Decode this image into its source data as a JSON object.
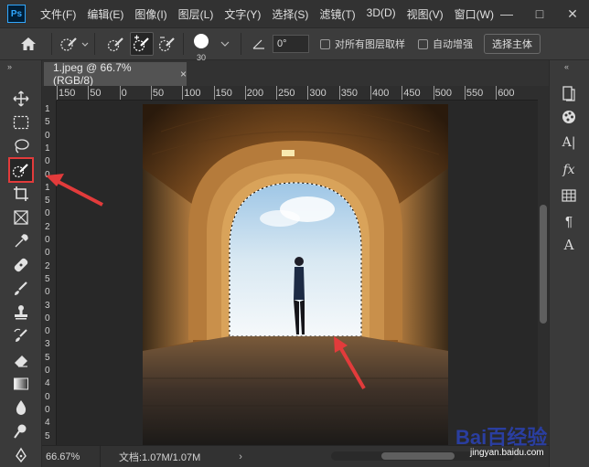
{
  "app": {
    "logo_text": "Ps",
    "menu": [
      "文件(F)",
      "编辑(E)",
      "图像(I)",
      "图层(L)",
      "文字(Y)",
      "选择(S)",
      "滤镜(T)",
      "3D(D)",
      "视图(V)",
      "窗口(W)"
    ]
  },
  "window_controls": {
    "minimize": "—",
    "maximize": "□",
    "close": "✕"
  },
  "options_bar": {
    "brush_size": "30",
    "angle_value": "0°",
    "sample_all_layers_label": "对所有图层取样",
    "auto_enhance_label": "自动增强",
    "select_subject_label": "选择主体"
  },
  "document": {
    "tab_title": "1.jpeg @ 66.7%(RGB/8)",
    "tab_close": "×"
  },
  "ruler": {
    "h_labels": [
      "150",
      "50",
      "0",
      "50",
      "100",
      "150",
      "200",
      "250",
      "300",
      "350",
      "400",
      "450",
      "500",
      "550",
      "600"
    ],
    "v_labels": [
      "1",
      "5",
      "0",
      "1",
      "0",
      "0",
      "1",
      "5",
      "0",
      "2",
      "0",
      "0",
      "2",
      "5",
      "0",
      "3",
      "0",
      "0",
      "3",
      "5",
      "0",
      "4",
      "0",
      "0",
      "4",
      "5"
    ]
  },
  "status": {
    "zoom": "66.67%",
    "doc_size": "文档:1.07M/1.07M",
    "arrow": "›"
  },
  "toolbar": {
    "collapse": "»",
    "selected_tool": "quick-selection-tool"
  },
  "right_dock": {
    "collapse": "«",
    "char_panel": "A|",
    "fx_label": "fx",
    "para_panel": "¶",
    "glyph_panel": "A"
  },
  "watermark": {
    "brand": "Bai百经验",
    "url": "jingyan.baidu.com"
  },
  "colors": {
    "highlight_red": "#e23b3b",
    "photoshop_blue": "#31a8ff"
  }
}
